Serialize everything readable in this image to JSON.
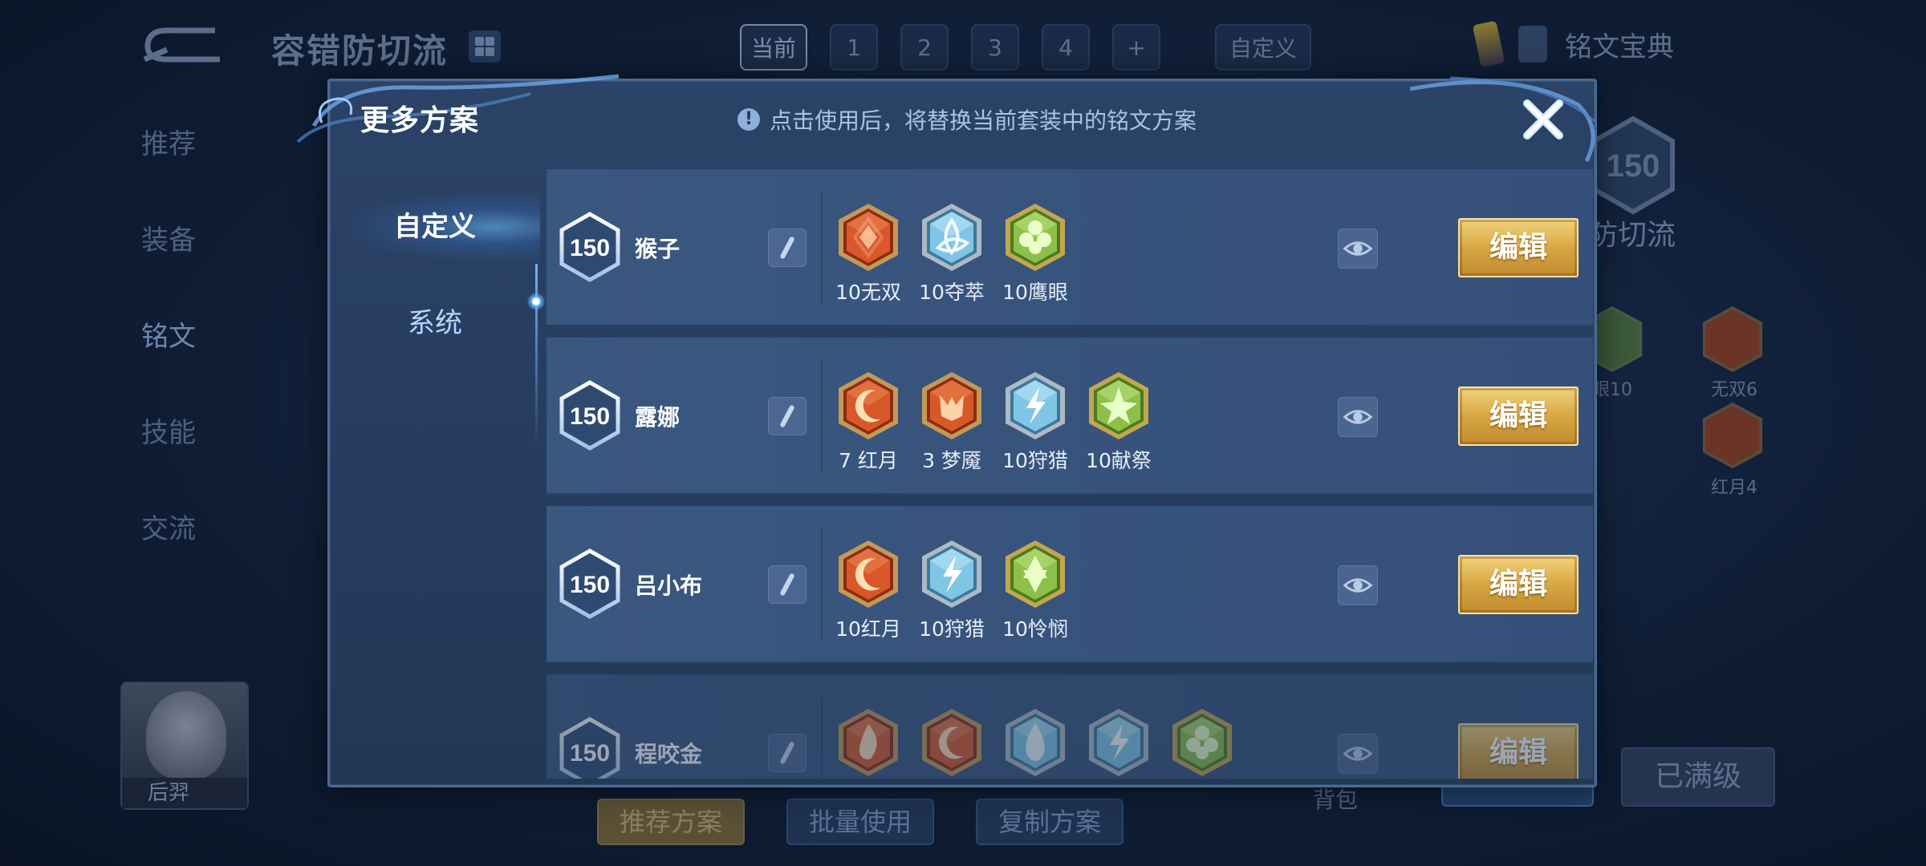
{
  "background": {
    "title": "容错防切流",
    "slot_tabs": [
      "当前",
      "1",
      "2",
      "3",
      "4",
      "+",
      "自定义"
    ],
    "guide_label": "铭文宝典",
    "nav": [
      "推荐",
      "装备",
      "铭文",
      "技能",
      "交流"
    ],
    "hero_name": "后羿",
    "bottom_buttons": [
      "推荐方案",
      "批量使用",
      "复制方案"
    ],
    "bag_label": "背包",
    "maxed_label": "已满级",
    "right_panel": {
      "level": "150",
      "plan_name": "防切流",
      "runes": [
        {
          "label": "眼10"
        },
        {
          "label": "无双6"
        },
        {
          "label": "红月4"
        }
      ]
    }
  },
  "modal": {
    "title": "更多方案",
    "hint": "点击使用后，将替换当前套装中的铭文方案",
    "side_tabs": {
      "custom": "自定义",
      "system": "系统"
    },
    "edit_label": "编辑",
    "rows": [
      {
        "level": "150",
        "name": "猴子",
        "runes": [
          {
            "label": "10无双",
            "kind": "red",
            "glyph": "diamond-swirl"
          },
          {
            "label": "10夺萃",
            "kind": "blue",
            "glyph": "triquetra"
          },
          {
            "label": "10鹰眼",
            "kind": "green",
            "glyph": "clover"
          }
        ]
      },
      {
        "level": "150",
        "name": "露娜",
        "runes": [
          {
            "label": "7 红月",
            "kind": "red",
            "glyph": "crescent"
          },
          {
            "label": "3 梦魇",
            "kind": "red",
            "glyph": "demon"
          },
          {
            "label": "10狩猎",
            "kind": "blue",
            "glyph": "lightning"
          },
          {
            "label": "10献祭",
            "kind": "green",
            "glyph": "star"
          }
        ]
      },
      {
        "level": "150",
        "name": "吕小布",
        "runes": [
          {
            "label": "10红月",
            "kind": "red",
            "glyph": "crescent"
          },
          {
            "label": "10狩猎",
            "kind": "blue",
            "glyph": "lightning"
          },
          {
            "label": "10怜悯",
            "kind": "green",
            "glyph": "hexagram"
          }
        ]
      },
      {
        "level": "150",
        "name": "程咬金",
        "runes": [
          {
            "label": "",
            "kind": "red",
            "glyph": "flame"
          },
          {
            "label": "",
            "kind": "red",
            "glyph": "crescent"
          },
          {
            "label": "",
            "kind": "blue",
            "glyph": "drop"
          },
          {
            "label": "",
            "kind": "blue",
            "glyph": "lightning"
          },
          {
            "label": "",
            "kind": "green",
            "glyph": "clover"
          }
        ]
      }
    ]
  },
  "colors": {
    "rune_red": "#d9582a",
    "rune_blue": "#7fc6e6",
    "rune_green": "#8cc04a",
    "gold_button": "#d7a744",
    "modal_bg": "#2b4367"
  }
}
